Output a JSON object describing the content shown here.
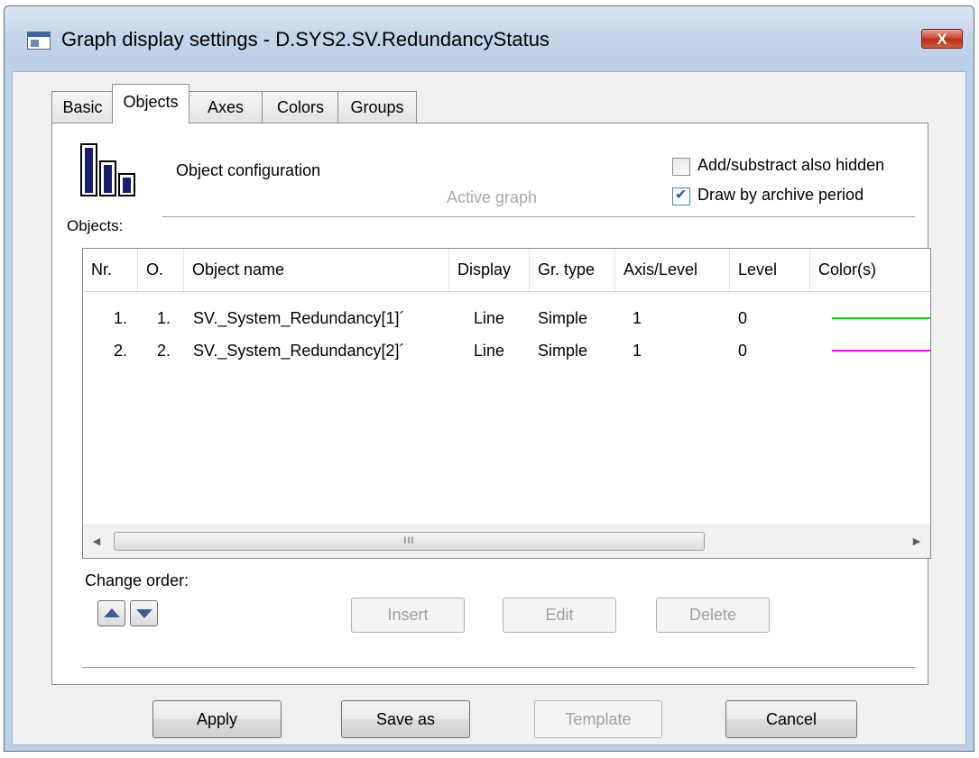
{
  "window": {
    "title": "Graph display settings - D.SYS2.SV.RedundancyStatus",
    "close_label": "X"
  },
  "tabs": [
    {
      "label": "Basic"
    },
    {
      "label": "Objects"
    },
    {
      "label": "Axes"
    },
    {
      "label": "Colors"
    },
    {
      "label": "Groups"
    }
  ],
  "active_tab": "Objects",
  "panel": {
    "heading": "Object configuration",
    "active_graph": "Active graph",
    "objects_label": "Objects:",
    "options": {
      "add_hidden": {
        "label": "Add/substract also hidden",
        "checked": false
      },
      "archive_period": {
        "label": "Draw by archive period",
        "checked": true
      }
    }
  },
  "table": {
    "columns": [
      "Nr.",
      "O.",
      "Object name",
      "Display",
      "Gr. type",
      "Axis/Level",
      "Level",
      "Color(s)"
    ],
    "rows": [
      {
        "nr": "1.",
        "o": "1.",
        "name": "SV._System_Redundancy[1]´",
        "display": "Line",
        "gr_type": "Simple",
        "axis": "1",
        "level": "0",
        "color": "#00e000"
      },
      {
        "nr": "2.",
        "o": "2.",
        "name": "SV._System_Redundancy[2]´",
        "display": "Line",
        "gr_type": "Simple",
        "axis": "1",
        "level": "0",
        "color": "#ff00ff"
      }
    ],
    "scroll_grip": "III"
  },
  "order": {
    "label": "Change order:"
  },
  "actions": {
    "insert": "Insert",
    "edit": "Edit",
    "delete": "Delete"
  },
  "footer": {
    "apply": "Apply",
    "save_as": "Save as",
    "template": "Template",
    "cancel": "Cancel"
  }
}
